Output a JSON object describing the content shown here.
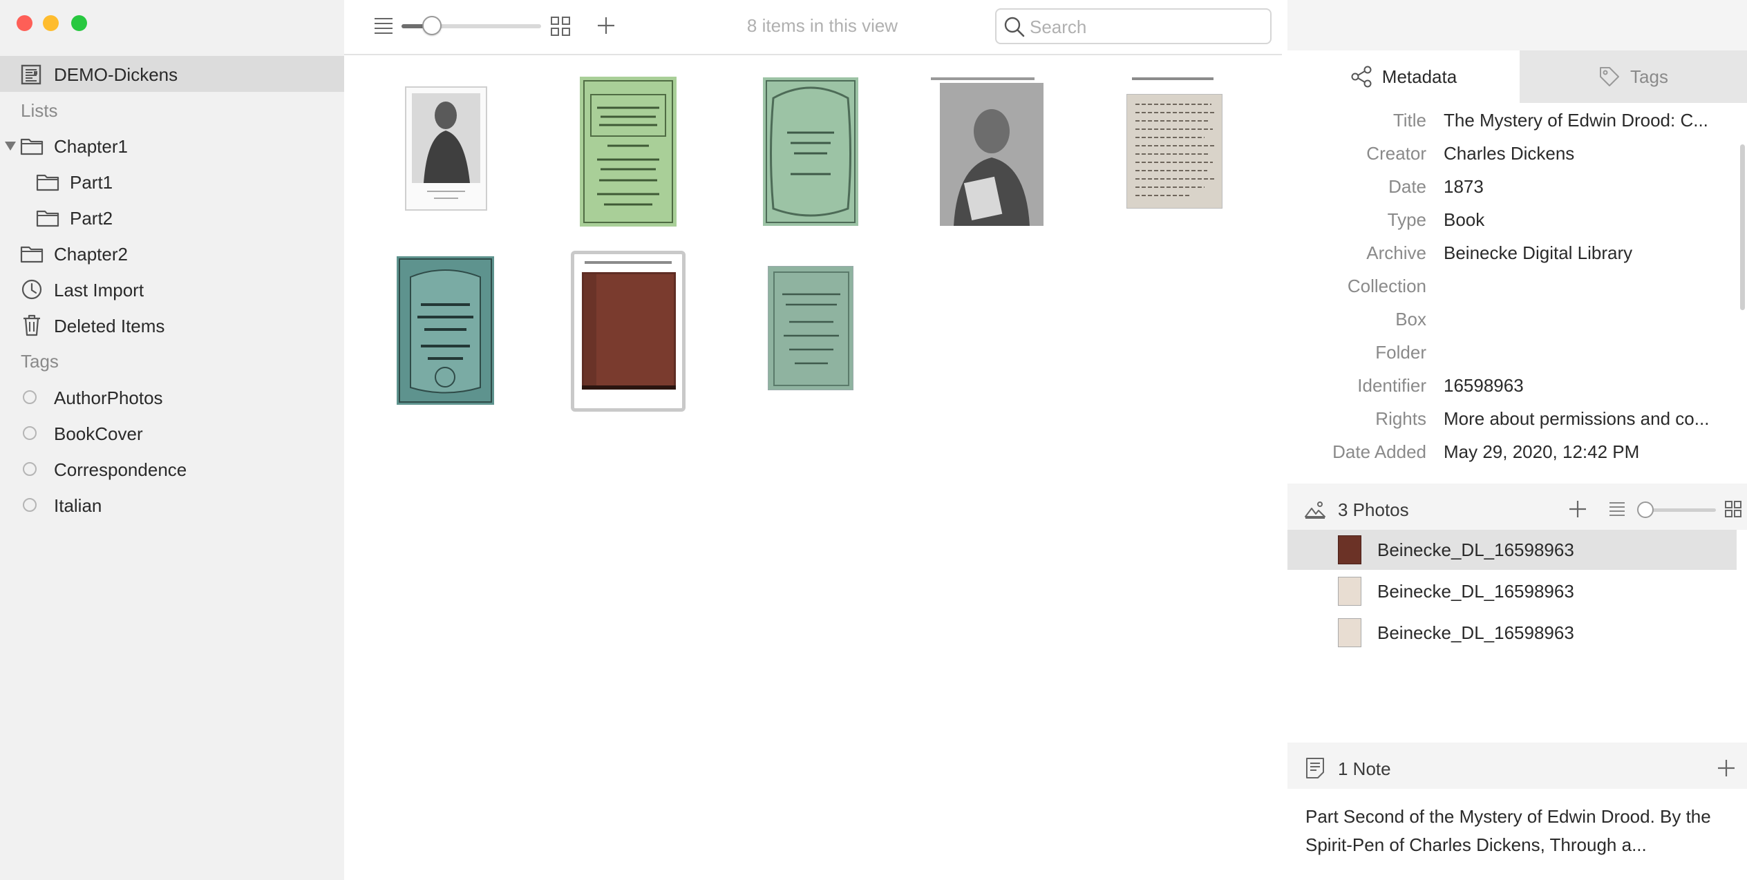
{
  "sidebar": {
    "project": "DEMO-Dickens",
    "lists_heading": "Lists",
    "lists": [
      {
        "label": "Chapter1",
        "expanded": true
      },
      {
        "label": "Part1"
      },
      {
        "label": "Part2"
      },
      {
        "label": "Chapter2"
      }
    ],
    "last_import": "Last Import",
    "deleted_items": "Deleted Items",
    "tags_heading": "Tags",
    "tags": [
      "AuthorPhotos",
      "BookCover",
      "Correspondence",
      "Italian"
    ]
  },
  "toolbar": {
    "items_count": "8 items in this view",
    "search_placeholder": "Search",
    "zoom_level": 0.22
  },
  "grid": {
    "items": [
      {
        "kind": "portrait-engraving",
        "selected": false,
        "stacked": false
      },
      {
        "kind": "green-magazine-cover",
        "selected": false,
        "stacked": false
      },
      {
        "kind": "green-ornate-cover",
        "selected": false,
        "stacked": false
      },
      {
        "kind": "portrait-painting",
        "selected": false,
        "stacked": true
      },
      {
        "kind": "handwritten-letter",
        "selected": false,
        "stacked": true
      },
      {
        "kind": "green-drood-cover",
        "selected": false,
        "stacked": false
      },
      {
        "kind": "brown-book",
        "selected": true,
        "stacked": true
      },
      {
        "kind": "green-pamphlet",
        "selected": false,
        "stacked": false
      }
    ]
  },
  "panel": {
    "tabs": {
      "metadata": "Metadata",
      "tags": "Tags"
    },
    "metadata": [
      {
        "key": "Title",
        "value": "The Mystery of Edwin Drood: C..."
      },
      {
        "key": "Creator",
        "value": "Charles Dickens"
      },
      {
        "key": "Date",
        "value": "1873"
      },
      {
        "key": "Type",
        "value": "Book"
      },
      {
        "key": "Archive",
        "value": "Beinecke Digital Library"
      },
      {
        "key": "Collection",
        "value": ""
      },
      {
        "key": "Box",
        "value": ""
      },
      {
        "key": "Folder",
        "value": ""
      },
      {
        "key": "Identifier",
        "value": "16598963"
      },
      {
        "key": "Rights",
        "value": "More about permissions and co..."
      },
      {
        "key": "Date Added",
        "value": "May 29, 2020, 12:42 PM"
      }
    ],
    "photos": {
      "header": "3 Photos",
      "items": [
        {
          "name": "Beinecke_DL_16598963",
          "selected": true
        },
        {
          "name": "Beinecke_DL_16598963",
          "selected": false
        },
        {
          "name": "Beinecke_DL_16598963",
          "selected": false
        }
      ]
    },
    "notes": {
      "header": "1 Note",
      "text": "Part Second of the Mystery of Edwin Drood. By the Spirit-Pen of Charles Dickens, Through a..."
    }
  },
  "colors": {
    "sidebar_bg": "#f1f1f1",
    "selection": "#dcdcdc",
    "book_brown": "#6b3226",
    "cover_green": "#9cc69a"
  }
}
